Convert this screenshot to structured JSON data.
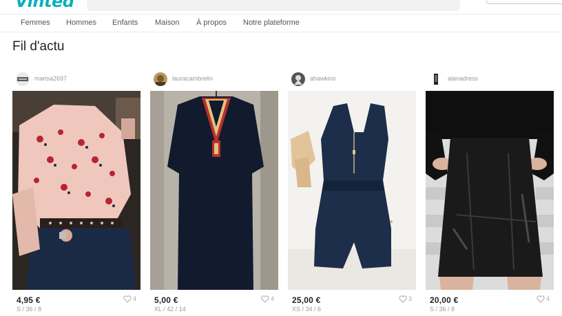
{
  "app": {
    "logo": "Vinted"
  },
  "nav": {
    "items": [
      "Femmes",
      "Hommes",
      "Enfants",
      "Maison",
      "À propos",
      "Notre plateforme"
    ]
  },
  "page_title": "Fil d'actu",
  "items": [
    {
      "username": "marisa2697",
      "price": "4,95 €",
      "favorites": "4",
      "size": "S / 36 / 8",
      "avatar_icon": "avatar-photo-icon"
    },
    {
      "username": "lauracambrelin",
      "price": "5,00 €",
      "favorites": "4",
      "size": "XL / 42 / 14",
      "avatar_icon": "avatar-photo-icon"
    },
    {
      "username": "ahawkins",
      "price": "25,00 €",
      "favorites": "3",
      "size": "XS / 34 / 6",
      "avatar_icon": "avatar-photo-icon"
    },
    {
      "username": "alanadress",
      "price": "20,00 €",
      "favorites": "4",
      "size": "S / 36 / 8",
      "avatar_icon": "avatar-photo-icon"
    }
  ],
  "colors": {
    "brand": "#09b1ba",
    "text": "#222222",
    "muted": "#999999"
  }
}
